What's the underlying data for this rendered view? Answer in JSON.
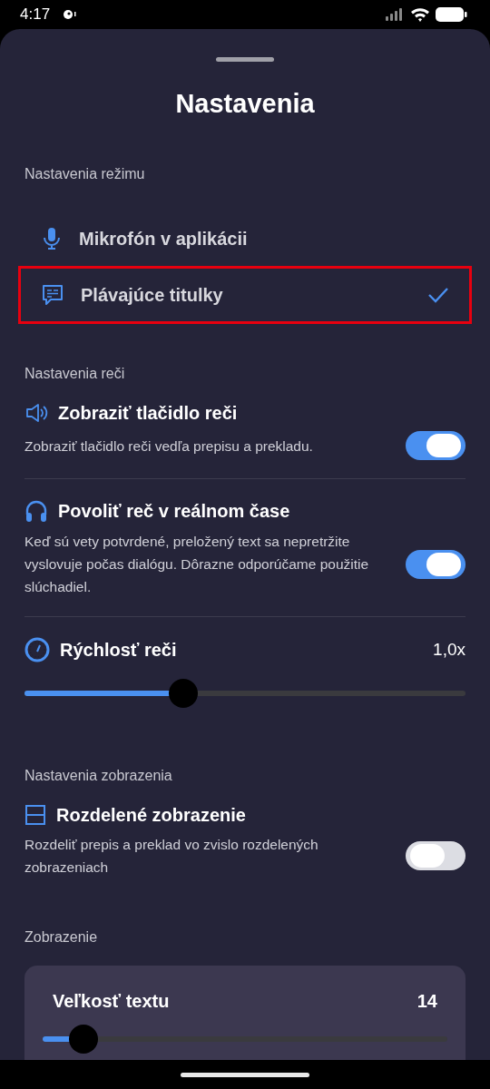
{
  "status_bar": {
    "time": "4:17"
  },
  "title": "Nastavenia",
  "mode_section": {
    "label": "Nastavenia režimu",
    "items": [
      {
        "label": "Mikrofón v aplikácii",
        "selected": false
      },
      {
        "label": "Plávajúce titulky",
        "selected": true
      }
    ]
  },
  "speech_section": {
    "label": "Nastavenia reči",
    "items": [
      {
        "kind": "toggle",
        "title": "Zobraziť tlačidlo reči",
        "description": "Zobraziť tlačidlo reči vedľa prepisu a prekladu.",
        "on": true
      },
      {
        "kind": "toggle",
        "title": "Povoliť reč v reálnom čase",
        "description": "Keď sú vety potvrdené, preložený text sa nepretržite vyslovuje počas dialógu. Dôrazne odporúčame použitie slúchadiel.",
        "on": true
      },
      {
        "kind": "slider",
        "title": "Rýchlosť reči",
        "reading": "1,0x",
        "level": 0.36
      }
    ]
  },
  "view_section": {
    "label": "Nastavenia zobrazenia",
    "items": [
      {
        "kind": "toggle",
        "title": "Rozdelené zobrazenie",
        "description": "Rozdeliť prepis a preklad vo zvislo rozdelených zobrazeniach",
        "on": false
      }
    ]
  },
  "display_section": {
    "label": "Zobrazenie",
    "card": {
      "title": "Veľkosť textu",
      "reading": "14",
      "level": 0.1
    }
  }
}
